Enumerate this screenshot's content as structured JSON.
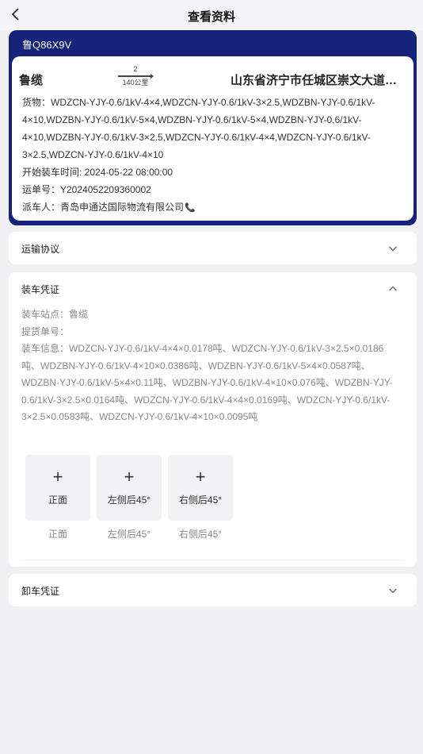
{
  "nav": {
    "title": "查看资料"
  },
  "vehicle": {
    "plate": "鲁Q86X9V",
    "route": {
      "from": "鲁缆",
      "count": "2",
      "distance": "140公里",
      "to": "山东省济宁市任城区崇文大道南侧"
    },
    "cargo": "货物：WDZCN-YJY-0.6/1kV-4×4,WDZCN-YJY-0.6/1kV-3×2.5,WDZBN-YJY-0.6/1kV-4×10,WDZBN-YJY-0.6/1kV-5×4,WDZBN-YJY-0.6/1kV-5×4,WDZBN-YJY-0.6/1kV-4×10,WDZBN-YJY-0.6/1kV-3×2.5,WDZCN-YJY-0.6/1kV-4×4,WDZCN-YJY-0.6/1kV-3×2.5,WDZCN-YJY-0.6/1kV-4×10",
    "start_time": "开始装车时间: 2024-05-22 08:00:00",
    "waybill": "运单号：Y2024052209360002",
    "dispatcher": "派车人：青岛申通达国际物流有限公司",
    "phone_icon": "phone-icon",
    "accent_color": "#16237a"
  },
  "sections": {
    "transport": {
      "title": "运输协议"
    },
    "loading": {
      "title": "装车凭证",
      "station": "装车站点：鲁缆",
      "pickup_no": "提货单号：",
      "info": "装车信息：WDZCN-YJY-0.6/1kV-4×4×0.0178吨、WDZCN-YJY-0.6/1kV-3×2.5×0.0186吨、WDZBN-YJY-0.6/1kV-4×10×0.0386吨、WDZBN-YJY-0.6/1kV-5×4×0.0587吨、WDZBN-YJY-0.6/1kV-5×4×0.11吨、WDZBN-YJY-0.6/1kV-4×10×0.076吨、WDZBN-YJY-0.6/1kV-3×2.5×0.0164吨、WDZCN-YJY-0.6/1kV-4×4×0.0169吨、WDZCN-YJY-0.6/1kV-3×2.5×0.0583吨、WDZCN-YJY-0.6/1kV-4×10×0.0095吨",
      "photos": [
        {
          "plus": "+",
          "tile_label": "正面",
          "caption": "正面"
        },
        {
          "plus": "+",
          "tile_label": "左侧后45°",
          "caption": "左侧后45°"
        },
        {
          "plus": "+",
          "tile_label": "右侧后45°",
          "caption": "右侧后45°"
        }
      ]
    },
    "unloading": {
      "title": "卸车凭证"
    }
  }
}
